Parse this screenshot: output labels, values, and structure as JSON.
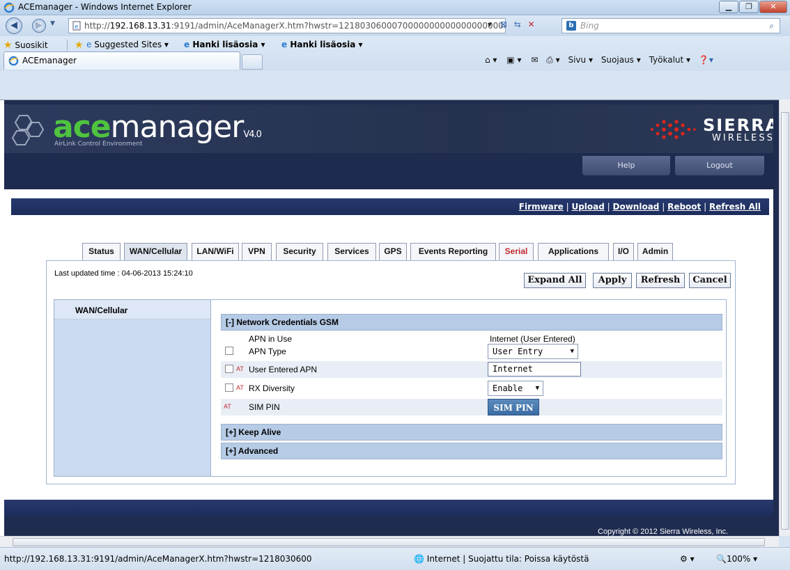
{
  "window": {
    "title": "ACEmanager - Windows Internet Explorer"
  },
  "address": {
    "url_prefix": "http://",
    "url_host": "192.168.13.31",
    "url_rest": ":9191/admin/AceManagerX.htm?hwstr=1218030600070000000000000000000&",
    "search_placeholder": "Bing"
  },
  "favorites": {
    "favorites_label": "Suosikit",
    "items": [
      "Suggested Sites ▾",
      "Hanki lisäosia ▾",
      "Hanki lisäosia ▾"
    ]
  },
  "tab": {
    "label": "ACEmanager"
  },
  "commandbar": {
    "items": [
      "Sivu ▾",
      "Suojaus ▾",
      "Työkalut ▾"
    ]
  },
  "app": {
    "logo_ace": "ace",
    "logo_manager": "manager",
    "version": "V4.0",
    "logo_tagline": "AirLink Control Environment",
    "brand_name": "SIERRA",
    "brand_sub": "WIRELESS",
    "nav": {
      "help": "Help",
      "logout": "Logout"
    },
    "links": [
      "Firmware",
      "Upload",
      "Download",
      "Reboot",
      "Refresh All"
    ],
    "tabs": [
      "Status",
      "WAN/Cellular",
      "LAN/WiFi",
      "VPN",
      "Security",
      "Services",
      "GPS",
      "Events Reporting",
      "Serial",
      "Applications",
      "I/O",
      "Admin"
    ],
    "active_tab": "WAN/Cellular",
    "last_updated": "Last updated time : 04-06-2013 15:24:10",
    "buttons": {
      "expand_all": "Expand All",
      "apply": "Apply",
      "refresh": "Refresh",
      "cancel": "Cancel"
    },
    "left_nav_header": "WAN/Cellular",
    "sections": {
      "network_credentials": "[-] Network Credentials GSM",
      "keep_alive": "[+] Keep Alive",
      "advanced": "[+] Advanced"
    },
    "rows": {
      "apn_in_use": {
        "label": "APN in Use",
        "value": "Internet (User Entered)"
      },
      "apn_type": {
        "label": "APN Type",
        "value": "User Entry"
      },
      "user_apn": {
        "at": "AT",
        "label": "User Entered APN",
        "value": "Internet"
      },
      "rx_diversity": {
        "at": "AT",
        "label": "RX Diversity",
        "value": "Enable"
      },
      "sim_pin": {
        "at": "AT",
        "label": "SIM PIN",
        "button": "SIM PIN"
      }
    },
    "copyright": "Copyright © 2012 Sierra Wireless, Inc."
  },
  "status": {
    "url": "http://192.168.13.31:9191/admin/AceManagerX.htm?hwstr=1218030600",
    "zone": "Internet | Suojattu tila: Poissa käytöstä",
    "zoom": "100%"
  },
  "colors": {
    "header_bg": "#1e2a4e",
    "ace_green": "#4fc33f",
    "section_header": "#b6cbe6",
    "serial_red": "#c0282e"
  }
}
